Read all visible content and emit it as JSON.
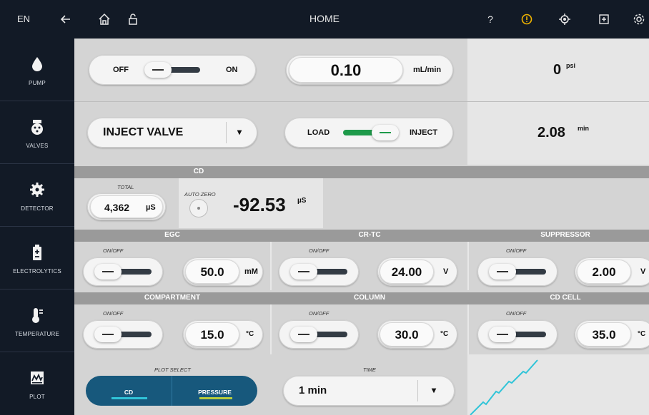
{
  "topbar": {
    "language": "EN",
    "title": "HOME",
    "help": "?",
    "colors": {
      "background": "#121a26",
      "warning": "#f0b400"
    },
    "icons": [
      "back-arrow-icon",
      "home-icon",
      "unlock-icon",
      "warning-icon",
      "target-icon",
      "add-box-icon",
      "settings-icon"
    ]
  },
  "sidebar": {
    "items": [
      {
        "label": "PUMP",
        "icon": "drop-icon"
      },
      {
        "label": "VALVES",
        "icon": "valve-icon"
      },
      {
        "label": "DETECTOR",
        "icon": "gear-icon"
      },
      {
        "label": "ELECTROLYTICS",
        "icon": "battery-icon"
      },
      {
        "label": "TEMPERATURE",
        "icon": "thermometer-icon"
      },
      {
        "label": "PLOT",
        "icon": "chart-icon"
      }
    ]
  },
  "pump": {
    "off_label": "OFF",
    "on_label": "ON",
    "flow_value": "0.10",
    "flow_unit": "mL/min",
    "pressure_value": "0",
    "pressure_unit": "psi"
  },
  "valves": {
    "select_label": "INJECT VALVE",
    "caret": "▾",
    "load_label": "LOAD",
    "inject_label": "INJECT",
    "time_value": "2.08",
    "time_unit": "min",
    "active_color": "#1e9a4a"
  },
  "detector": {
    "header": "CD",
    "total_caption": "TOTAL",
    "total_value": "4,362",
    "total_unit": "µS",
    "autozero_caption": "AUTO ZERO",
    "reading_value": "-92.53",
    "reading_unit": "µS"
  },
  "electrolytics": {
    "modules": [
      {
        "header": "EGC",
        "caption": "ON/OFF",
        "value": "50.0",
        "unit": "mM"
      },
      {
        "header": "CR-TC",
        "caption": "ON/OFF",
        "value": "24.00",
        "unit": "V"
      },
      {
        "header": "SUPPRESSOR",
        "caption": "ON/OFF",
        "value": "2.00",
        "unit": "V"
      }
    ]
  },
  "temperature": {
    "modules": [
      {
        "header": "COMPARTMENT",
        "caption": "ON/OFF",
        "value": "15.0",
        "unit": "°C"
      },
      {
        "header": "COLUMN",
        "caption": "ON/OFF",
        "value": "30.0",
        "unit": "°C"
      },
      {
        "header": "CD CELL",
        "caption": "ON/OFF",
        "value": "35.0",
        "unit": "°C"
      }
    ]
  },
  "plot": {
    "select_caption": "PLOT SELECT",
    "cd_label": "CD",
    "pressure_label": "PRESSURE",
    "time_caption": "TIME",
    "time_value": "1 min",
    "caret": "▾",
    "colors": {
      "cd": "#30c4d8",
      "pressure": "#b8cc3c",
      "segment": "#17587c"
    }
  }
}
